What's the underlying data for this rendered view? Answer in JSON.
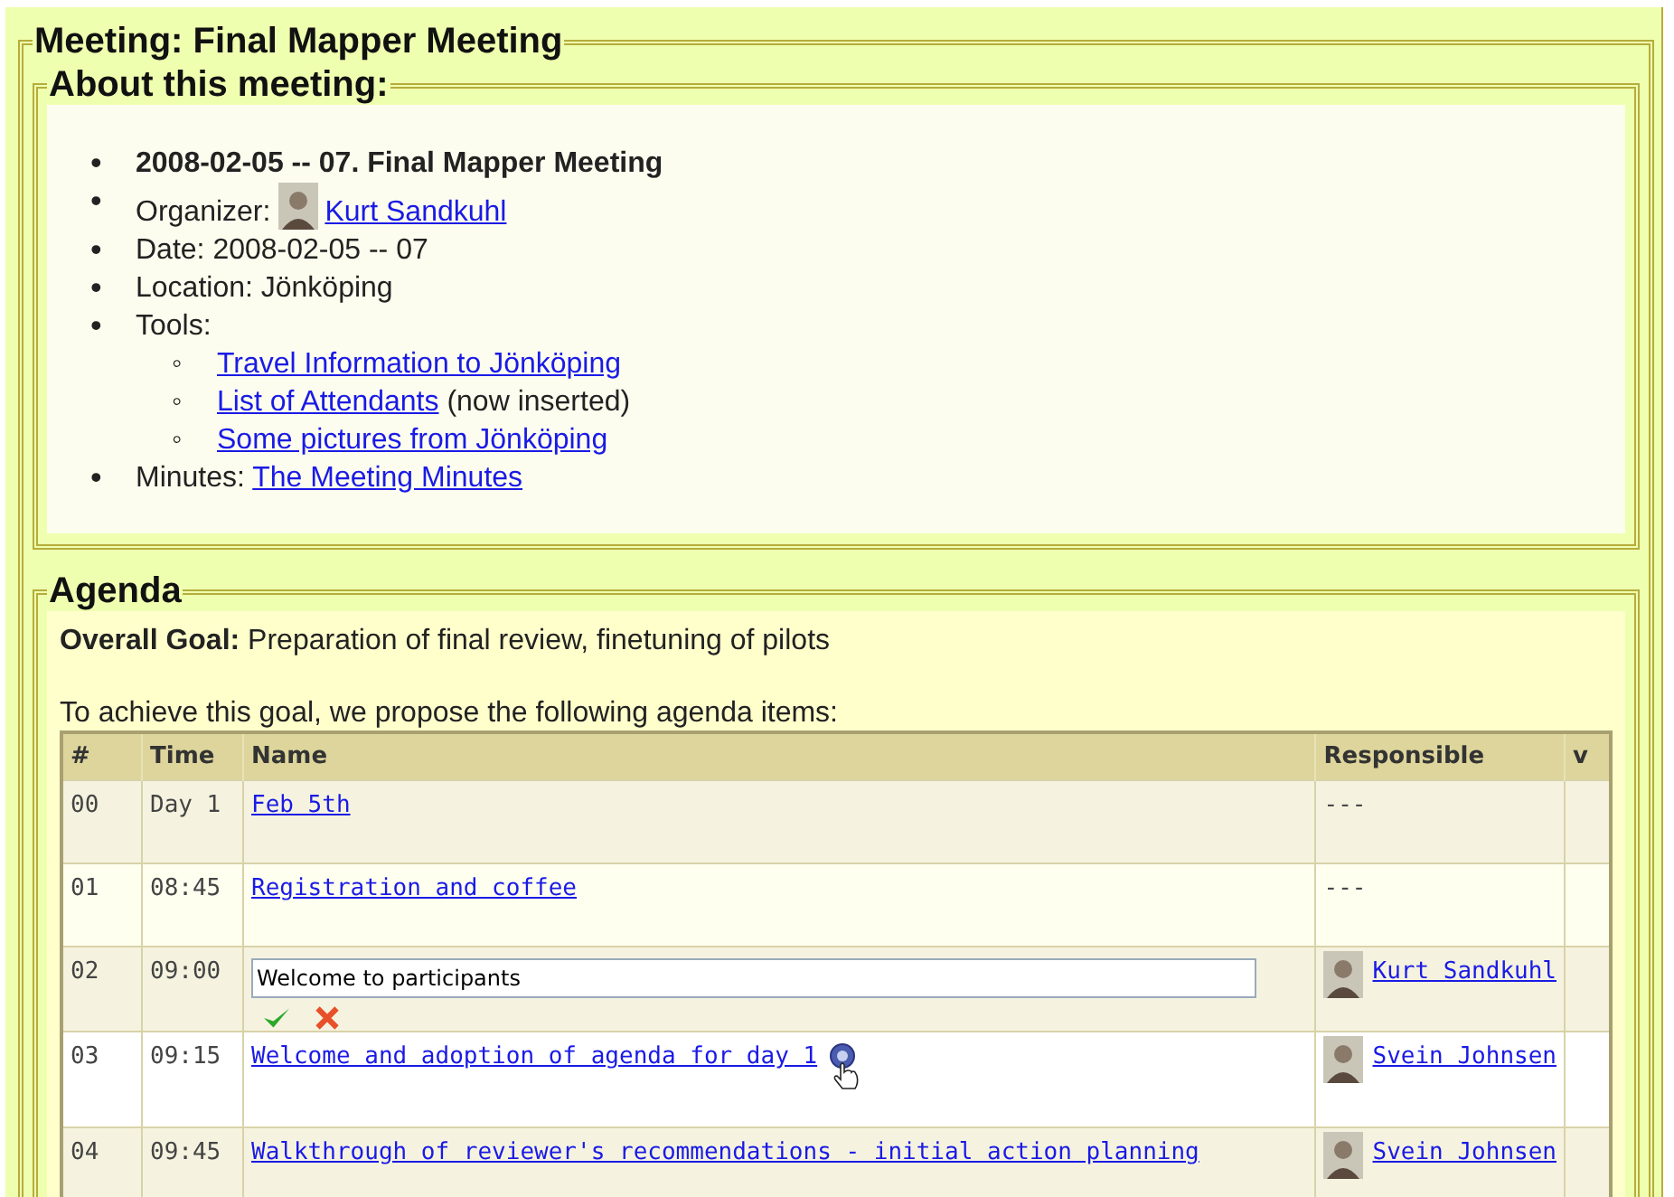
{
  "meeting": {
    "title": "Meeting: Final Mapper Meeting"
  },
  "about": {
    "legend": "About this meeting:",
    "items": [
      {
        "kind": "heading",
        "marker": "•",
        "text": "2008-02-05 -- 07. Final Mapper Meeting"
      },
      {
        "kind": "organizer",
        "marker": "•",
        "label": "Organizer:",
        "name": "Kurt Sandkuhl"
      },
      {
        "kind": "text",
        "marker": "•",
        "text": "Date: 2008-02-05 -- 07"
      },
      {
        "kind": "text",
        "marker": "•",
        "text": "Location: Jönköping"
      },
      {
        "kind": "tools",
        "marker": "•",
        "label": "Tools:",
        "children": [
          {
            "marker": "◦",
            "link": "Travel Information to Jönköping"
          },
          {
            "marker": "◦",
            "link": "List of Attendants",
            "note": "(now inserted)"
          },
          {
            "marker": "◦",
            "link": "Some pictures from Jönköping"
          }
        ]
      },
      {
        "kind": "minutes",
        "marker": "•",
        "label": "Minutes:",
        "link": "The Meeting Minutes"
      }
    ]
  },
  "agenda": {
    "legend": "Agenda",
    "goal": "**Overall Goal:** Preparation of final review, finetuning of pilots",
    "intro": "To achieve this goal, we propose the following agenda items:",
    "table": {
      "columns": [
        "#",
        "Time",
        "Name",
        "Responsible",
        "v"
      ],
      "rows": [
        {
          "number": "00",
          "time": "Day 1",
          "kind": "link",
          "name": "Feb 5th",
          "responsible": {
            "kind": "text",
            "text": "---"
          }
        },
        {
          "number": "01",
          "time": "08:45",
          "kind": "link",
          "name": "Registration and coffee",
          "responsible": {
            "kind": "text",
            "text": "---"
          }
        },
        {
          "number": "02",
          "time": "09:00",
          "kind": "editing",
          "name": "Welcome to participants",
          "responsible": {
            "kind": "person",
            "name": "Kurt Sandkuhl"
          }
        },
        {
          "number": "03",
          "time": "09:15",
          "kind": "link_help",
          "name": "Welcome and adoption of agenda for day 1",
          "responsible": {
            "kind": "person",
            "name": "Svein Johnsen"
          }
        },
        {
          "number": "04",
          "time": "09:45",
          "kind": "link",
          "name": "Walkthrough of reviewer's recommendations - initial action planning",
          "responsible": {
            "kind": "person",
            "name": "Svein Johnsen"
          }
        }
      ]
    }
  }
}
